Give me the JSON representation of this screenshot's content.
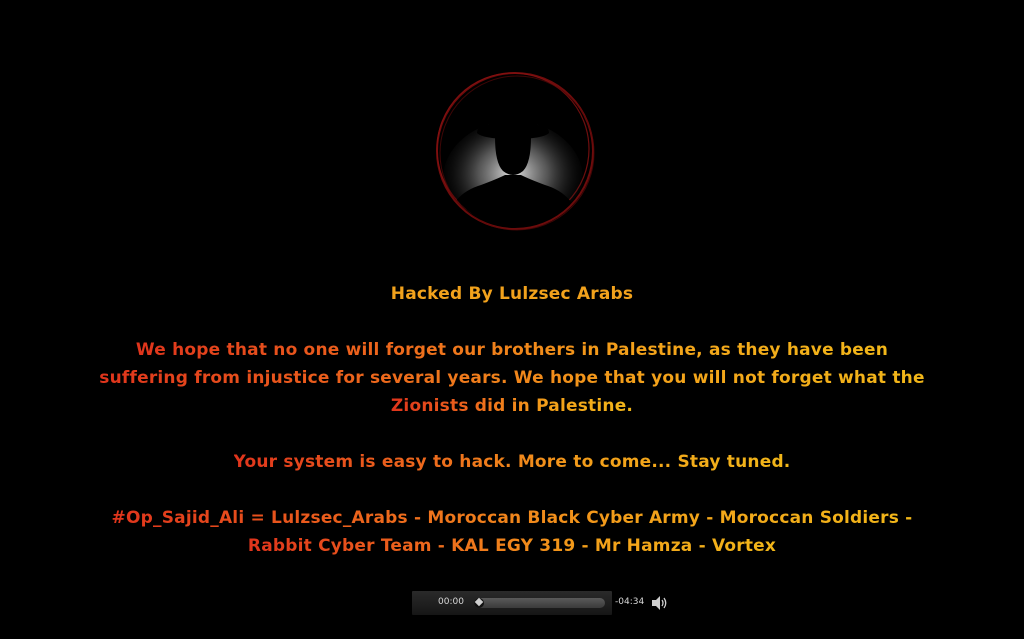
{
  "header": {
    "title": "Hacked By Lulzsec Arabs"
  },
  "message": {
    "text": "We hope that no one will forget our brothers in Palestine, as they have been suffering from injustice for several years. We hope that you will not forget what the Zionists did in Palestine."
  },
  "tagline": {
    "text": "Your system is easy to hack. More to come... Stay tuned."
  },
  "credits": {
    "lead": "#Op_Sajid_Ali",
    "text": " = Lulzsec_Arabs - Moroccan Black Cyber Army - Moroccan Soldiers - Rabbit Cyber Team - KAL EGY 319 - Mr Hamza - Vortex"
  },
  "audio_player": {
    "current_time": "00:00",
    "remaining_time": "-04:34",
    "progress": 0.0
  },
  "icons": {
    "avatar": "hooded-figure-silhouette",
    "volume": "speaker-volume-icon"
  },
  "colors": {
    "background": "#000000",
    "title": "#f2a21c",
    "text_start": "#e0341c",
    "text_end": "#f2b719",
    "ring": "#7a0e0e"
  }
}
